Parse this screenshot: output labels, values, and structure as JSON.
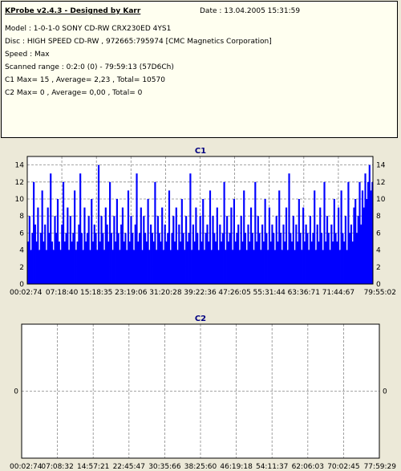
{
  "header": {
    "title": "KProbe v2.4.3 - Designed by Karr",
    "date": "Date : 13.04.2005 15:31:59",
    "lines": [
      "Model : 1-0-1-0 SONY     CD-RW  CRX230ED  4YS1",
      "Disc : HIGH SPEED CD-RW , 972665:795974 [CMC Magnetics Corporation]",
      "Speed : Max",
      "Scanned range : 0:2:0 (0) - 79:59:13 (57D6Ch)",
      "C1 Max= 15 , Average= 2,23 , Total= 10570",
      "C2 Max= 0 , Average= 0,00 , Total= 0"
    ]
  },
  "colors": {
    "plot_bg": "#ffffff",
    "bar_fill": "#0000ff",
    "grid": "#888888",
    "title": "#000080",
    "frame": "#000000"
  },
  "chart_data": [
    {
      "type": "bar",
      "title": "C1",
      "xlabel": "",
      "ylabel": "",
      "ylim": [
        0,
        15
      ],
      "yticks": [
        0,
        2,
        4,
        6,
        8,
        10,
        12,
        14
      ],
      "xticks": [
        "00:02:74",
        "07:18:40",
        "15:18:35",
        "23:19:06",
        "31:20:28",
        "39:22:36",
        "47:26:05",
        "55:31:44",
        "63:36:71",
        "71:44:67",
        "79:55:02"
      ],
      "grid": "dashed horizontal",
      "max": 15,
      "average": 2.23,
      "values": [
        5,
        8,
        4,
        6,
        12,
        7,
        5,
        9,
        4,
        6,
        11,
        5,
        7,
        4,
        9,
        6,
        13,
        5,
        4,
        8,
        6,
        10,
        5,
        4,
        7,
        12,
        5,
        6,
        9,
        4,
        8,
        5,
        6,
        11,
        4,
        5,
        7,
        13,
        6,
        4,
        9,
        5,
        6,
        8,
        4,
        10,
        5,
        7,
        6,
        4,
        14,
        5,
        8,
        6,
        4,
        9,
        7,
        5,
        12,
        6,
        4,
        8,
        5,
        10,
        6,
        4,
        7,
        9,
        5,
        6,
        4,
        11,
        5,
        8,
        6,
        4,
        7,
        13,
        5,
        6,
        9,
        4,
        8,
        6,
        5,
        10,
        4,
        7,
        6,
        5,
        12,
        4,
        8,
        6,
        5,
        9,
        4,
        7,
        5,
        6,
        11,
        4,
        6,
        8,
        5,
        9,
        4,
        7,
        5,
        10,
        6,
        4,
        8,
        5,
        6,
        13,
        4,
        7,
        5,
        9,
        6,
        4,
        8,
        5,
        10,
        4,
        6,
        7,
        5,
        11,
        4,
        8,
        6,
        5,
        9,
        4,
        7,
        5,
        6,
        12,
        4,
        8,
        5,
        6,
        9,
        4,
        10,
        5,
        6,
        7,
        4,
        8,
        5,
        11,
        6,
        4,
        7,
        5,
        9,
        6,
        4,
        12,
        5,
        8,
        6,
        4,
        7,
        5,
        10,
        6,
        4,
        9,
        5,
        7,
        6,
        4,
        8,
        5,
        11,
        6,
        4,
        7,
        5,
        9,
        4,
        13,
        6,
        5,
        8,
        4,
        7,
        5,
        10,
        6,
        4,
        9,
        5,
        7,
        6,
        4,
        8,
        5,
        6,
        11,
        4,
        7,
        5,
        9,
        6,
        4,
        12,
        5,
        8,
        6,
        4,
        7,
        5,
        10,
        6,
        5,
        9,
        4,
        11,
        6,
        5,
        8,
        4,
        12,
        6,
        7,
        5,
        9,
        10,
        6,
        8,
        12,
        7,
        11,
        9,
        13,
        10,
        12,
        14,
        11,
        12
      ]
    },
    {
      "type": "bar",
      "title": "C2",
      "xlabel": "",
      "ylabel": "",
      "ylim": [
        -1,
        1
      ],
      "yticks": [
        0
      ],
      "xticks": [
        "00:02:74",
        "07:08:32",
        "14:57:21",
        "22:45:47",
        "30:35:66",
        "38:25:60",
        "46:19:18",
        "54:11:37",
        "62:06:03",
        "70:02:45",
        "77:59:29"
      ],
      "grid": "dashed horizontal",
      "max": 0,
      "average": 0,
      "values": []
    }
  ]
}
